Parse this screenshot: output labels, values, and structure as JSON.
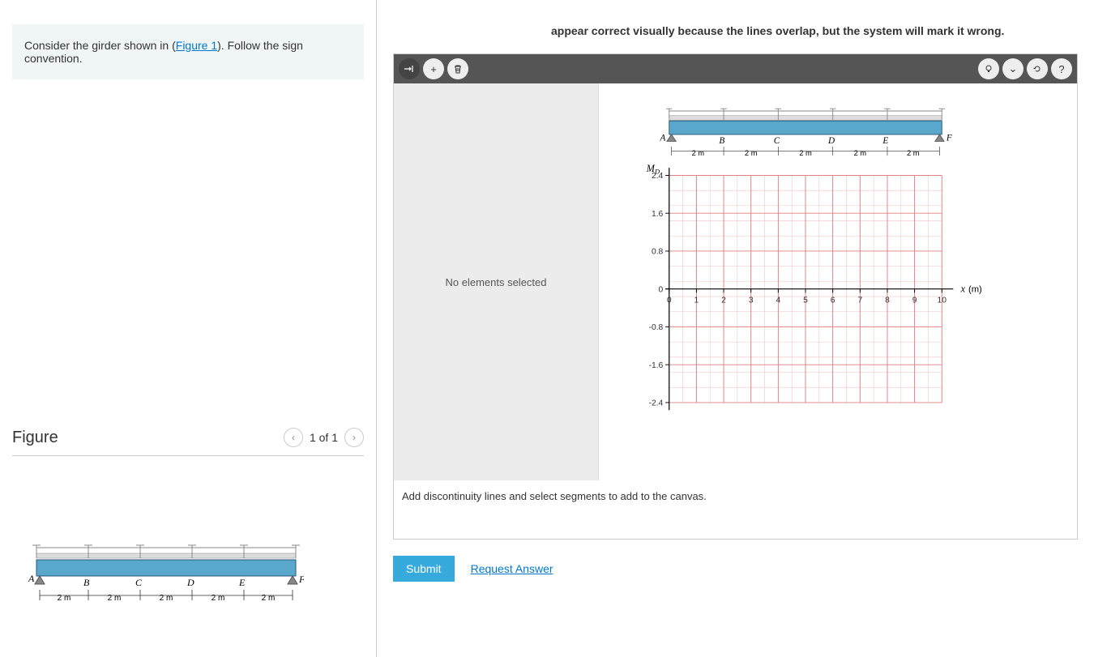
{
  "problem": {
    "text_before": "Consider the girder shown in (",
    "figure_link": "Figure 1",
    "text_after": "). Follow the sign convention."
  },
  "figure": {
    "title": "Figure",
    "page_indicator": "1 of 1",
    "beam": {
      "points": [
        "A",
        "B",
        "C",
        "D",
        "E",
        "F"
      ],
      "segments": [
        "2 m",
        "2 m",
        "2 m",
        "2 m",
        "2 m"
      ]
    }
  },
  "right": {
    "top_text": "appear correct visually because the lines overlap, but the system will mark it wrong.",
    "toolbar": {
      "draw": "↘",
      "add": "+",
      "delete": "🗑",
      "hint": "💡",
      "collapse": "⌄",
      "reset": "↻",
      "help": "?"
    },
    "sidebar_text": "No elements selected",
    "hint_text": "Add discontinuity lines and select segments to add to the canvas.",
    "graph": {
      "y_label": "M_D",
      "y_label_sub": "D",
      "x_label": "x (m)",
      "beam": {
        "points": [
          "A",
          "B",
          "C",
          "D",
          "E",
          "F"
        ],
        "segments": [
          "2 m",
          "2 m",
          "2 m",
          "2 m",
          "2 m"
        ]
      }
    },
    "submit_label": "Submit",
    "request_label": "Request Answer"
  },
  "chart_data": {
    "type": "scatter",
    "title": "",
    "xlabel": "x (m)",
    "ylabel": "M_D",
    "xlim": [
      0,
      10
    ],
    "ylim": [
      -2.4,
      2.4
    ],
    "x_ticks": [
      0,
      1,
      2,
      3,
      4,
      5,
      6,
      7,
      8,
      9,
      10
    ],
    "y_ticks": [
      -2.4,
      -1.6,
      -0.8,
      0.0,
      0.8,
      1.6,
      2.4
    ],
    "series": []
  }
}
